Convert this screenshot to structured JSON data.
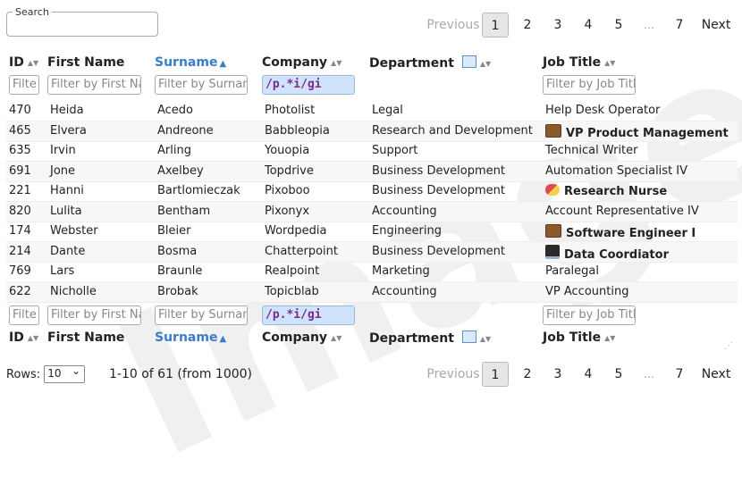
{
  "search": {
    "legend": "Search",
    "value": ""
  },
  "pager": {
    "prev": "Previous",
    "pages": [
      "1",
      "2",
      "3",
      "4",
      "5"
    ],
    "ellipsis": "…",
    "last": "7",
    "next": "Next",
    "current": "1"
  },
  "columns": [
    {
      "key": "id",
      "label": "ID",
      "sort": "none",
      "filter": "Filte"
    },
    {
      "key": "first",
      "label": "First Name",
      "sort": "none",
      "filter": "Filter by First Nar"
    },
    {
      "key": "surname",
      "label": "Surname",
      "sort": "asc",
      "filter": "Filter by Surnam"
    },
    {
      "key": "company",
      "label": "Company",
      "sort": "none",
      "filter": "/p.*i/gi"
    },
    {
      "key": "department",
      "label": "Department",
      "sort": "none",
      "filter": ""
    },
    {
      "key": "job",
      "label": "Job Title",
      "sort": "none",
      "filter": "Filter by Job Title"
    }
  ],
  "rows": [
    {
      "id": "470",
      "first": "Heida",
      "surname": "Acedo",
      "company": "Photolist",
      "department": "Legal",
      "job": "Help Desk Operator",
      "icon": "",
      "bold": false
    },
    {
      "id": "465",
      "first": "Elvera",
      "surname": "Andreone",
      "company": "Babbleopia",
      "department": "Research and Development",
      "job": "VP Product Management",
      "icon": "briefcase-icon",
      "bold": true
    },
    {
      "id": "635",
      "first": "Irvin",
      "surname": "Arling",
      "company": "Youopia",
      "department": "Support",
      "job": "Technical Writer",
      "icon": "",
      "bold": false
    },
    {
      "id": "691",
      "first": "Jone",
      "surname": "Axelbey",
      "company": "Topdrive",
      "department": "Business Development",
      "job": "Automation Specialist IV",
      "icon": "",
      "bold": false
    },
    {
      "id": "221",
      "first": "Hanni",
      "surname": "Bartlomieczak",
      "company": "Pixoboo",
      "department": "Business Development",
      "job": "Research Nurse",
      "icon": "pill-icon",
      "bold": true
    },
    {
      "id": "820",
      "first": "Lulita",
      "surname": "Bentham",
      "company": "Pixonyx",
      "department": "Accounting",
      "job": "Account Representative IV",
      "icon": "",
      "bold": false
    },
    {
      "id": "174",
      "first": "Webster",
      "surname": "Bleier",
      "company": "Wordpedia",
      "department": "Engineering",
      "job": "Software Engineer I",
      "icon": "briefcase-icon",
      "bold": true
    },
    {
      "id": "214",
      "first": "Dante",
      "surname": "Bosma",
      "company": "Chatterpoint",
      "department": "Business Development",
      "job": "Data Coordiator",
      "icon": "laptop-icon",
      "bold": true
    },
    {
      "id": "769",
      "first": "Lars",
      "surname": "Braunle",
      "company": "Realpoint",
      "department": "Marketing",
      "job": "Paralegal",
      "icon": "",
      "bold": false
    },
    {
      "id": "622",
      "first": "Nicholle",
      "surname": "Brobak",
      "company": "Topicblab",
      "department": "Accounting",
      "job": "VP Accounting",
      "icon": "",
      "bold": false
    }
  ],
  "footer": {
    "rows_label": "Rows:",
    "rows_value": "10",
    "range": "1-10 of 61 (from 1000)"
  },
  "watermark": "Image"
}
